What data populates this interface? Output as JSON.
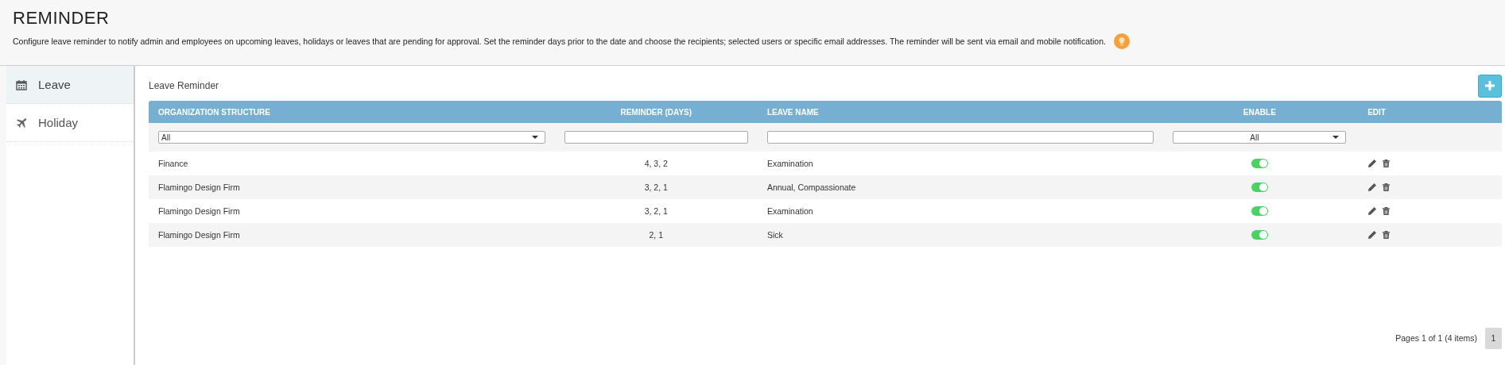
{
  "header": {
    "title": "REMINDER",
    "description": "Configure leave reminder to notify admin and employees on upcoming leaves, holidays or leaves that are pending for approval. Set the reminder days prior to the date and choose the recipients; selected users or specific email addresses. The reminder will be sent via email and mobile notification."
  },
  "sidebar": {
    "items": [
      {
        "label": "Leave",
        "kind": "calendar",
        "selected": true
      },
      {
        "label": "Holiday",
        "kind": "plane",
        "selected": false
      }
    ]
  },
  "panel": {
    "title": "Leave Reminder"
  },
  "table": {
    "columns": [
      "ORGANIZATION STRUCTURE",
      "REMINDER (DAYS)",
      "LEAVE NAME",
      "ENABLE",
      "EDIT"
    ],
    "filters": {
      "organization": "All",
      "enable": "All"
    },
    "rows": [
      {
        "organization": "Finance",
        "reminder": "4, 3, 2",
        "leave_name": "Examination",
        "enabled": true
      },
      {
        "organization": "Flamingo Design Firm",
        "reminder": "3, 2, 1",
        "leave_name": "Annual, Compassionate",
        "enabled": true
      },
      {
        "organization": "Flamingo Design Firm",
        "reminder": "3, 2, 1",
        "leave_name": "Examination",
        "enabled": true
      },
      {
        "organization": "Flamingo Design Firm",
        "reminder": "2, 1",
        "leave_name": "Sick",
        "enabled": true
      }
    ]
  },
  "pagination": {
    "summary": "Pages 1 of 1 (4 items)",
    "pages": [
      {
        "label": "1",
        "selected": true
      }
    ]
  }
}
